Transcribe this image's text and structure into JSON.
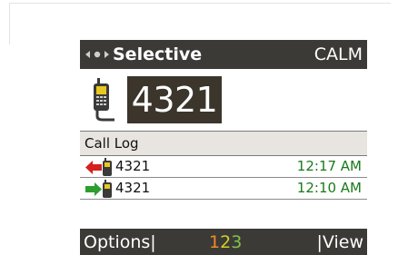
{
  "titlebar": {
    "title": "Selective",
    "status": "CALM",
    "mode_icon": "selective-call-icon"
  },
  "dial": {
    "number": "4321",
    "icon": "radio-handset-icon"
  },
  "call_log": {
    "header": "Call Log",
    "entries": [
      {
        "direction": "incoming",
        "number": "4321",
        "time": "12:17 AM",
        "arrow_color": "#d42020"
      },
      {
        "direction": "outgoing",
        "number": "4321",
        "time": "12:10 AM",
        "arrow_color": "#2e9e2e"
      }
    ]
  },
  "softkeys": {
    "left": "Options|",
    "middle_digits": [
      "1",
      "2",
      "3"
    ],
    "right": "|View"
  },
  "colors": {
    "bar_background": "#3c3a37",
    "entry_background": "#3b352c",
    "header_background": "#e8e4e0",
    "time_text": "#1a7a1a"
  }
}
